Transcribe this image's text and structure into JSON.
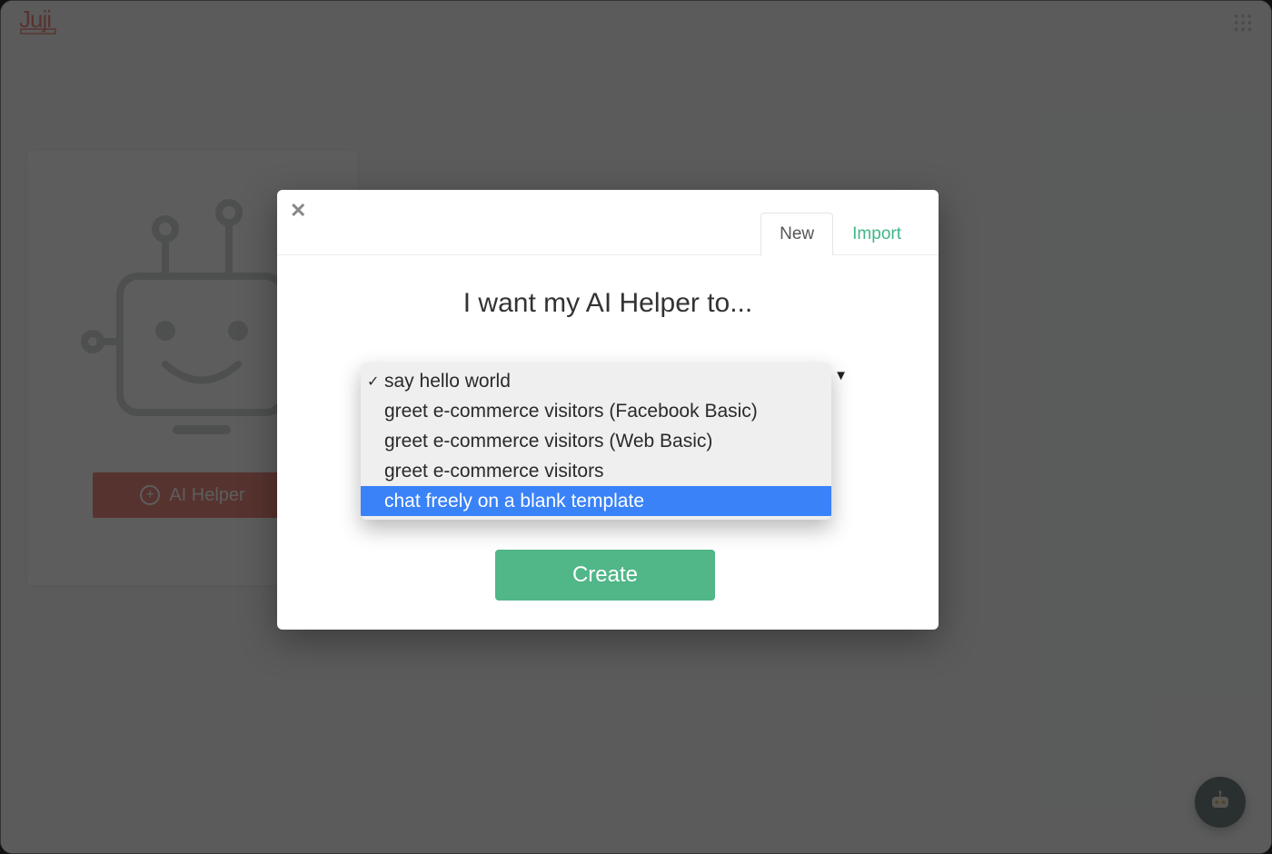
{
  "header": {
    "brand": "Juji"
  },
  "sidebar_card": {
    "button_label": "AI Helper"
  },
  "modal": {
    "tabs": {
      "new": "New",
      "import": "Import"
    },
    "title": "I want my AI Helper to...",
    "create_label": "Create",
    "dropdown": {
      "selected_index": 0,
      "highlight_index": 4,
      "options": [
        "say hello world",
        "greet e-commerce visitors (Facebook Basic)",
        "greet e-commerce visitors (Web Basic)",
        "greet e-commerce visitors",
        "chat freely on a blank template"
      ]
    }
  },
  "icons": {
    "apps": "apps-grid-icon",
    "close": "close-icon",
    "plus": "plus-circle-icon",
    "robot": "robot-illustration",
    "chat_fab": "chatbot-fab-icon",
    "dropdown_caret": "caret-down-icon"
  },
  "colors": {
    "accent_red": "#e86a5c",
    "accent_green": "#51b688",
    "link_green": "#3fb787",
    "highlight_blue": "#3a82f7",
    "overlay": "rgba(30,30,30,.72)"
  }
}
